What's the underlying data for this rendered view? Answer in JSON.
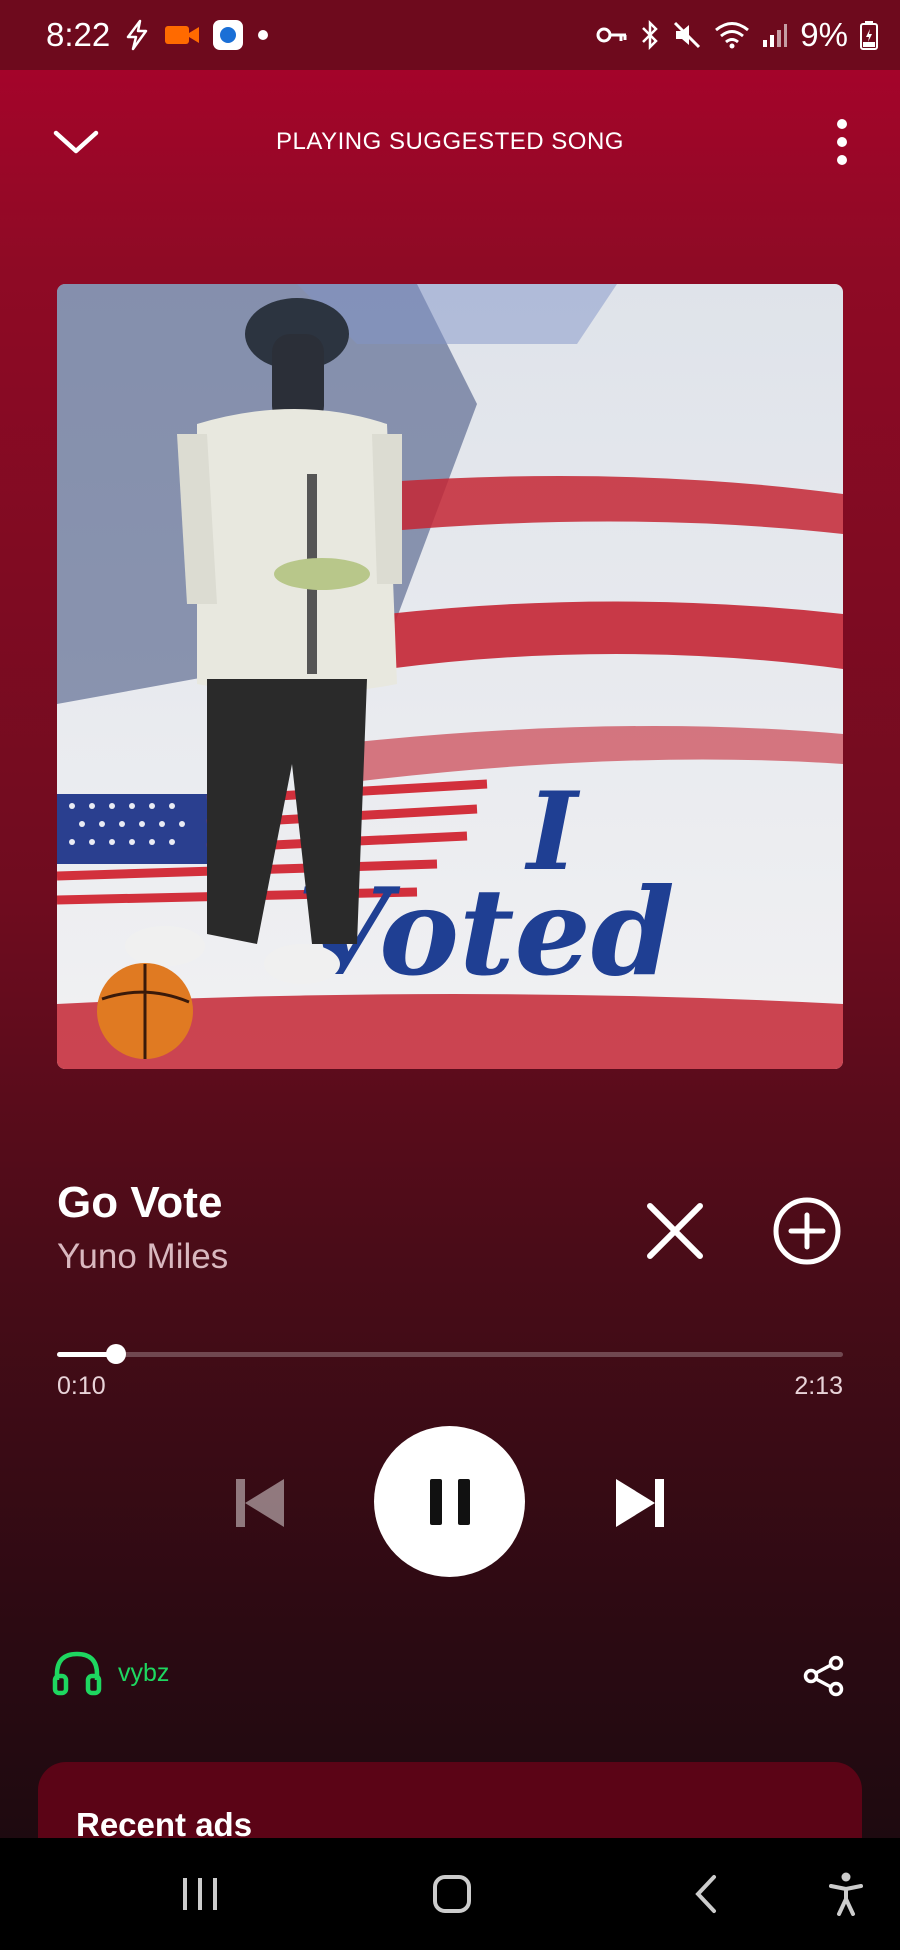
{
  "status_bar": {
    "time": "8:22",
    "battery": "9%",
    "icons_left": [
      "bolt-icon",
      "video-camera-icon",
      "app-notification-icon",
      "dot-icon"
    ],
    "icons_right": [
      "vpn-key-icon",
      "bluetooth-icon",
      "mute-icon",
      "wifi-icon",
      "signal-icon",
      "battery-icon"
    ]
  },
  "header": {
    "title": "PLAYING SUGGESTED SONG"
  },
  "artwork": {
    "description_icon": "album-art-image",
    "sticker_text_line1": "I",
    "sticker_text_line2": "Voted"
  },
  "track": {
    "title": "Go Vote",
    "artist": "Yuno Miles"
  },
  "progress": {
    "elapsed": "0:10",
    "total": "2:13",
    "fraction": 0.075
  },
  "device": {
    "label": "vybz"
  },
  "recent": {
    "title": "Recent ads"
  },
  "colors": {
    "accent_green": "#1ed760",
    "background_top": "#a4042a",
    "background_bottom": "#1e0a10"
  }
}
